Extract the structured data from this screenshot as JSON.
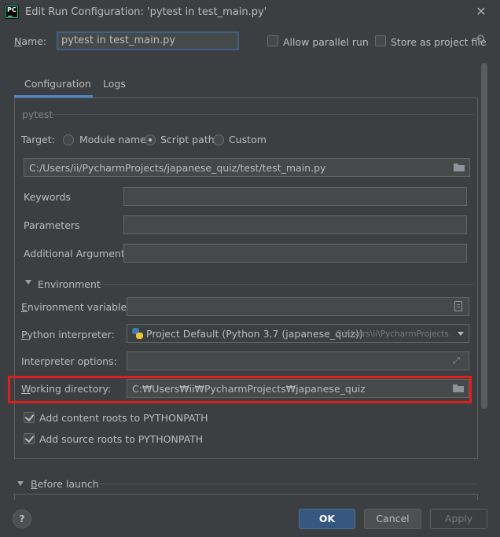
{
  "window": {
    "title": "Edit Run Configuration: 'pytest in test_main.py'",
    "app_icon_text": "PC"
  },
  "name_row": {
    "label": "Name:",
    "value": "pytest in test_main.py",
    "allow_parallel_label": "Allow parallel run",
    "allow_parallel_checked": false,
    "store_as_project_label": "Store as project file",
    "store_as_project_checked": false
  },
  "tabs": [
    {
      "label": "Configuration",
      "selected": true
    },
    {
      "label": "Logs",
      "selected": false
    }
  ],
  "pytest_section": {
    "title": "pytest",
    "target_label": "Target:",
    "target_options": [
      "Module name",
      "Script path",
      "Custom"
    ],
    "target_selected": "Script path",
    "script_path": "C:/Users/ii/PycharmProjects/japanese_quiz/test/test_main.py",
    "keywords_label": "Keywords",
    "keywords_value": "",
    "parameters_label": "Parameters",
    "parameters_value": "",
    "additional_args_label": "Additional Arguments",
    "additional_args_value": ""
  },
  "environment": {
    "title": "Environment",
    "env_vars_label": "Environment variables:",
    "env_vars_value": "",
    "interpreter_label": "Python interpreter:",
    "interpreter_value": "Project Default (Python 3.7 (japanese_quiz))",
    "interpreter_path_hint": "C:\\Users\\ii\\PycharmProjects",
    "interpreter_options_label": "Interpreter options:",
    "interpreter_options_value": "",
    "working_dir_label": "Working directory:",
    "working_dir_value": "C:₩Users₩ii₩PycharmProjects₩japanese_quiz",
    "content_roots_label": "Add content roots to PYTHONPATH",
    "content_roots_checked": true,
    "source_roots_label": "Add source roots to PYTHONPATH",
    "source_roots_checked": true
  },
  "before_launch": {
    "title": "Before launch"
  },
  "buttons": {
    "help": "?",
    "ok": "OK",
    "cancel": "Cancel",
    "apply": "Apply"
  },
  "colors": {
    "background": "#3c3f41",
    "accent": "#4a88c7",
    "ok_button": "#365880",
    "highlight_box": "#e31d1d"
  }
}
